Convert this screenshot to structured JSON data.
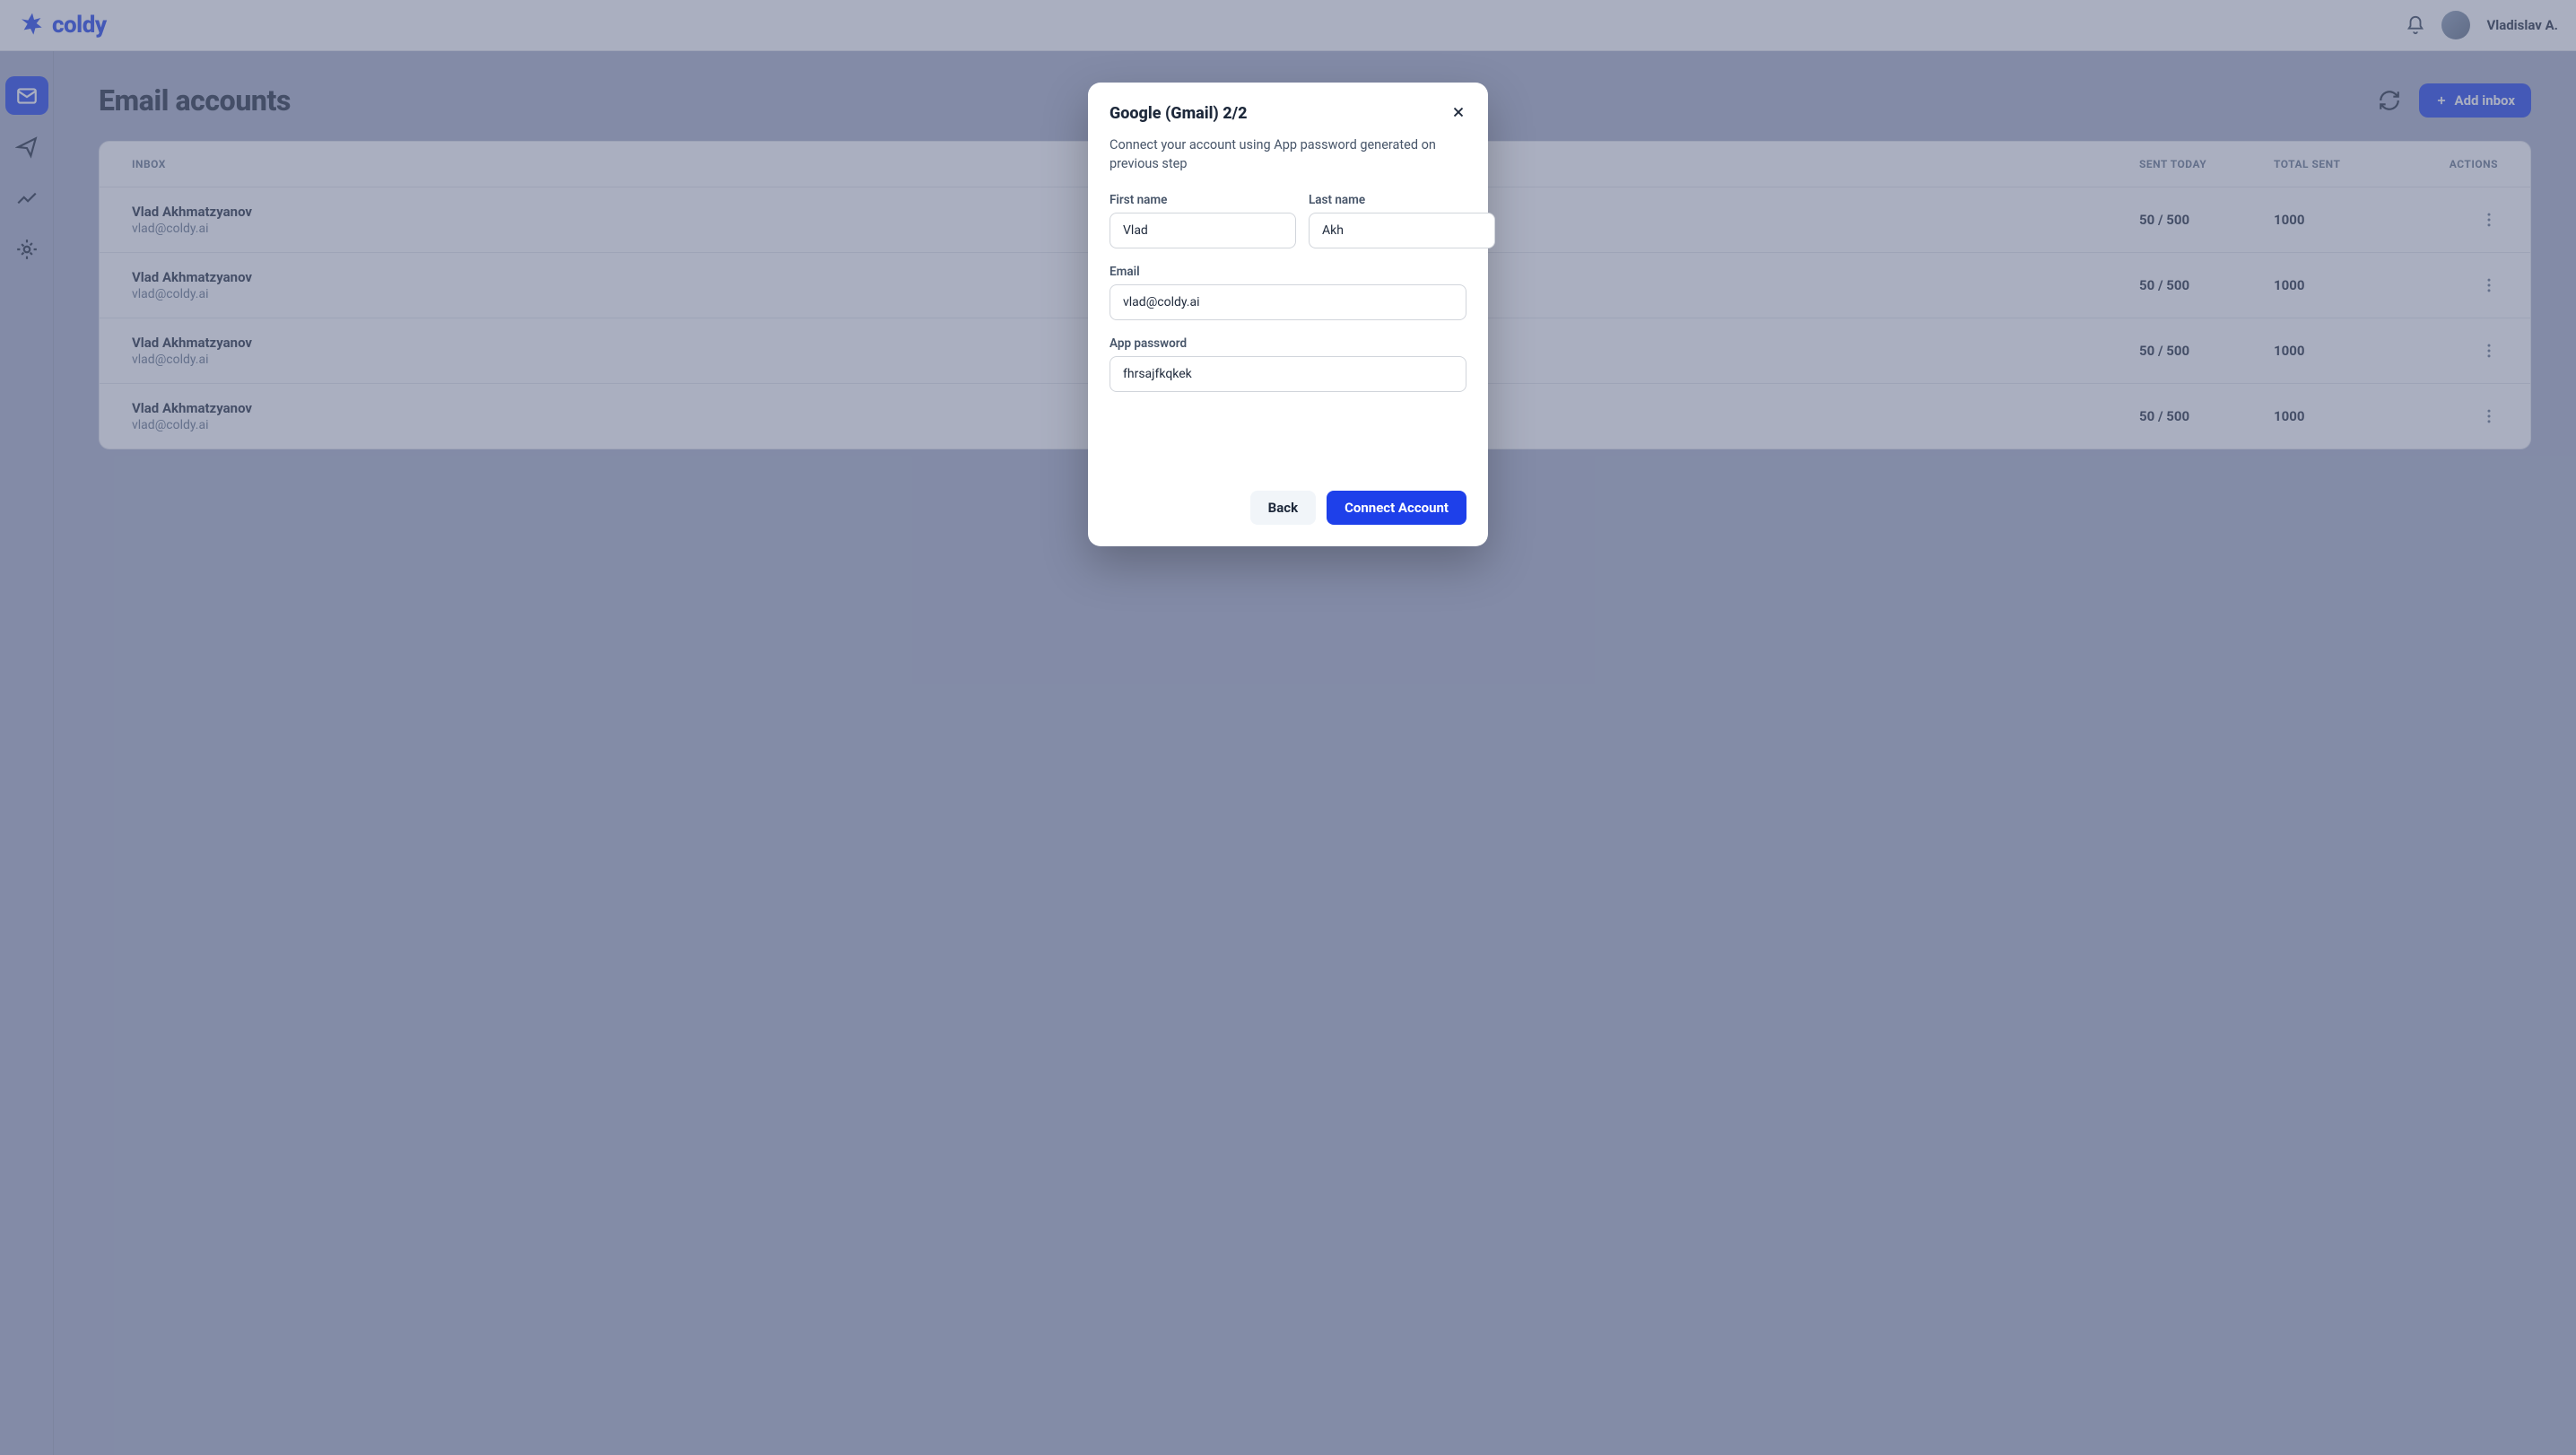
{
  "brand": {
    "name": "coldy"
  },
  "topbar": {
    "user_name": "Vladislav A."
  },
  "page": {
    "title": "Email accounts",
    "add_button": "Add inbox"
  },
  "table": {
    "columns": {
      "inbox": "INBOX",
      "sent_today": "SENT TODAY",
      "total_sent": "TOTAL SENT",
      "actions": "ACTIONS"
    },
    "rows": [
      {
        "name": "Vlad Akhmatzyanov",
        "email": "vlad@coldy.ai",
        "sent_today": "50 / 500",
        "total_sent": "1000"
      },
      {
        "name": "Vlad Akhmatzyanov",
        "email": "vlad@coldy.ai",
        "sent_today": "50 / 500",
        "total_sent": "1000"
      },
      {
        "name": "Vlad Akhmatzyanov",
        "email": "vlad@coldy.ai",
        "sent_today": "50 / 500",
        "total_sent": "1000"
      },
      {
        "name": "Vlad Akhmatzyanov",
        "email": "vlad@coldy.ai",
        "sent_today": "50 / 500",
        "total_sent": "1000"
      }
    ]
  },
  "modal": {
    "title": "Google (Gmail) 2/2",
    "subtitle": "Connect your account using App password generated on previous step",
    "fields": {
      "first_name_label": "First name",
      "first_name_value": "Vlad",
      "last_name_label": "Last name",
      "last_name_value": "Akh",
      "email_label": "Email",
      "email_value": "vlad@coldy.ai",
      "app_password_label": "App password",
      "app_password_value": "fhrsajfkqkek"
    },
    "buttons": {
      "back": "Back",
      "connect": "Connect Account"
    }
  }
}
